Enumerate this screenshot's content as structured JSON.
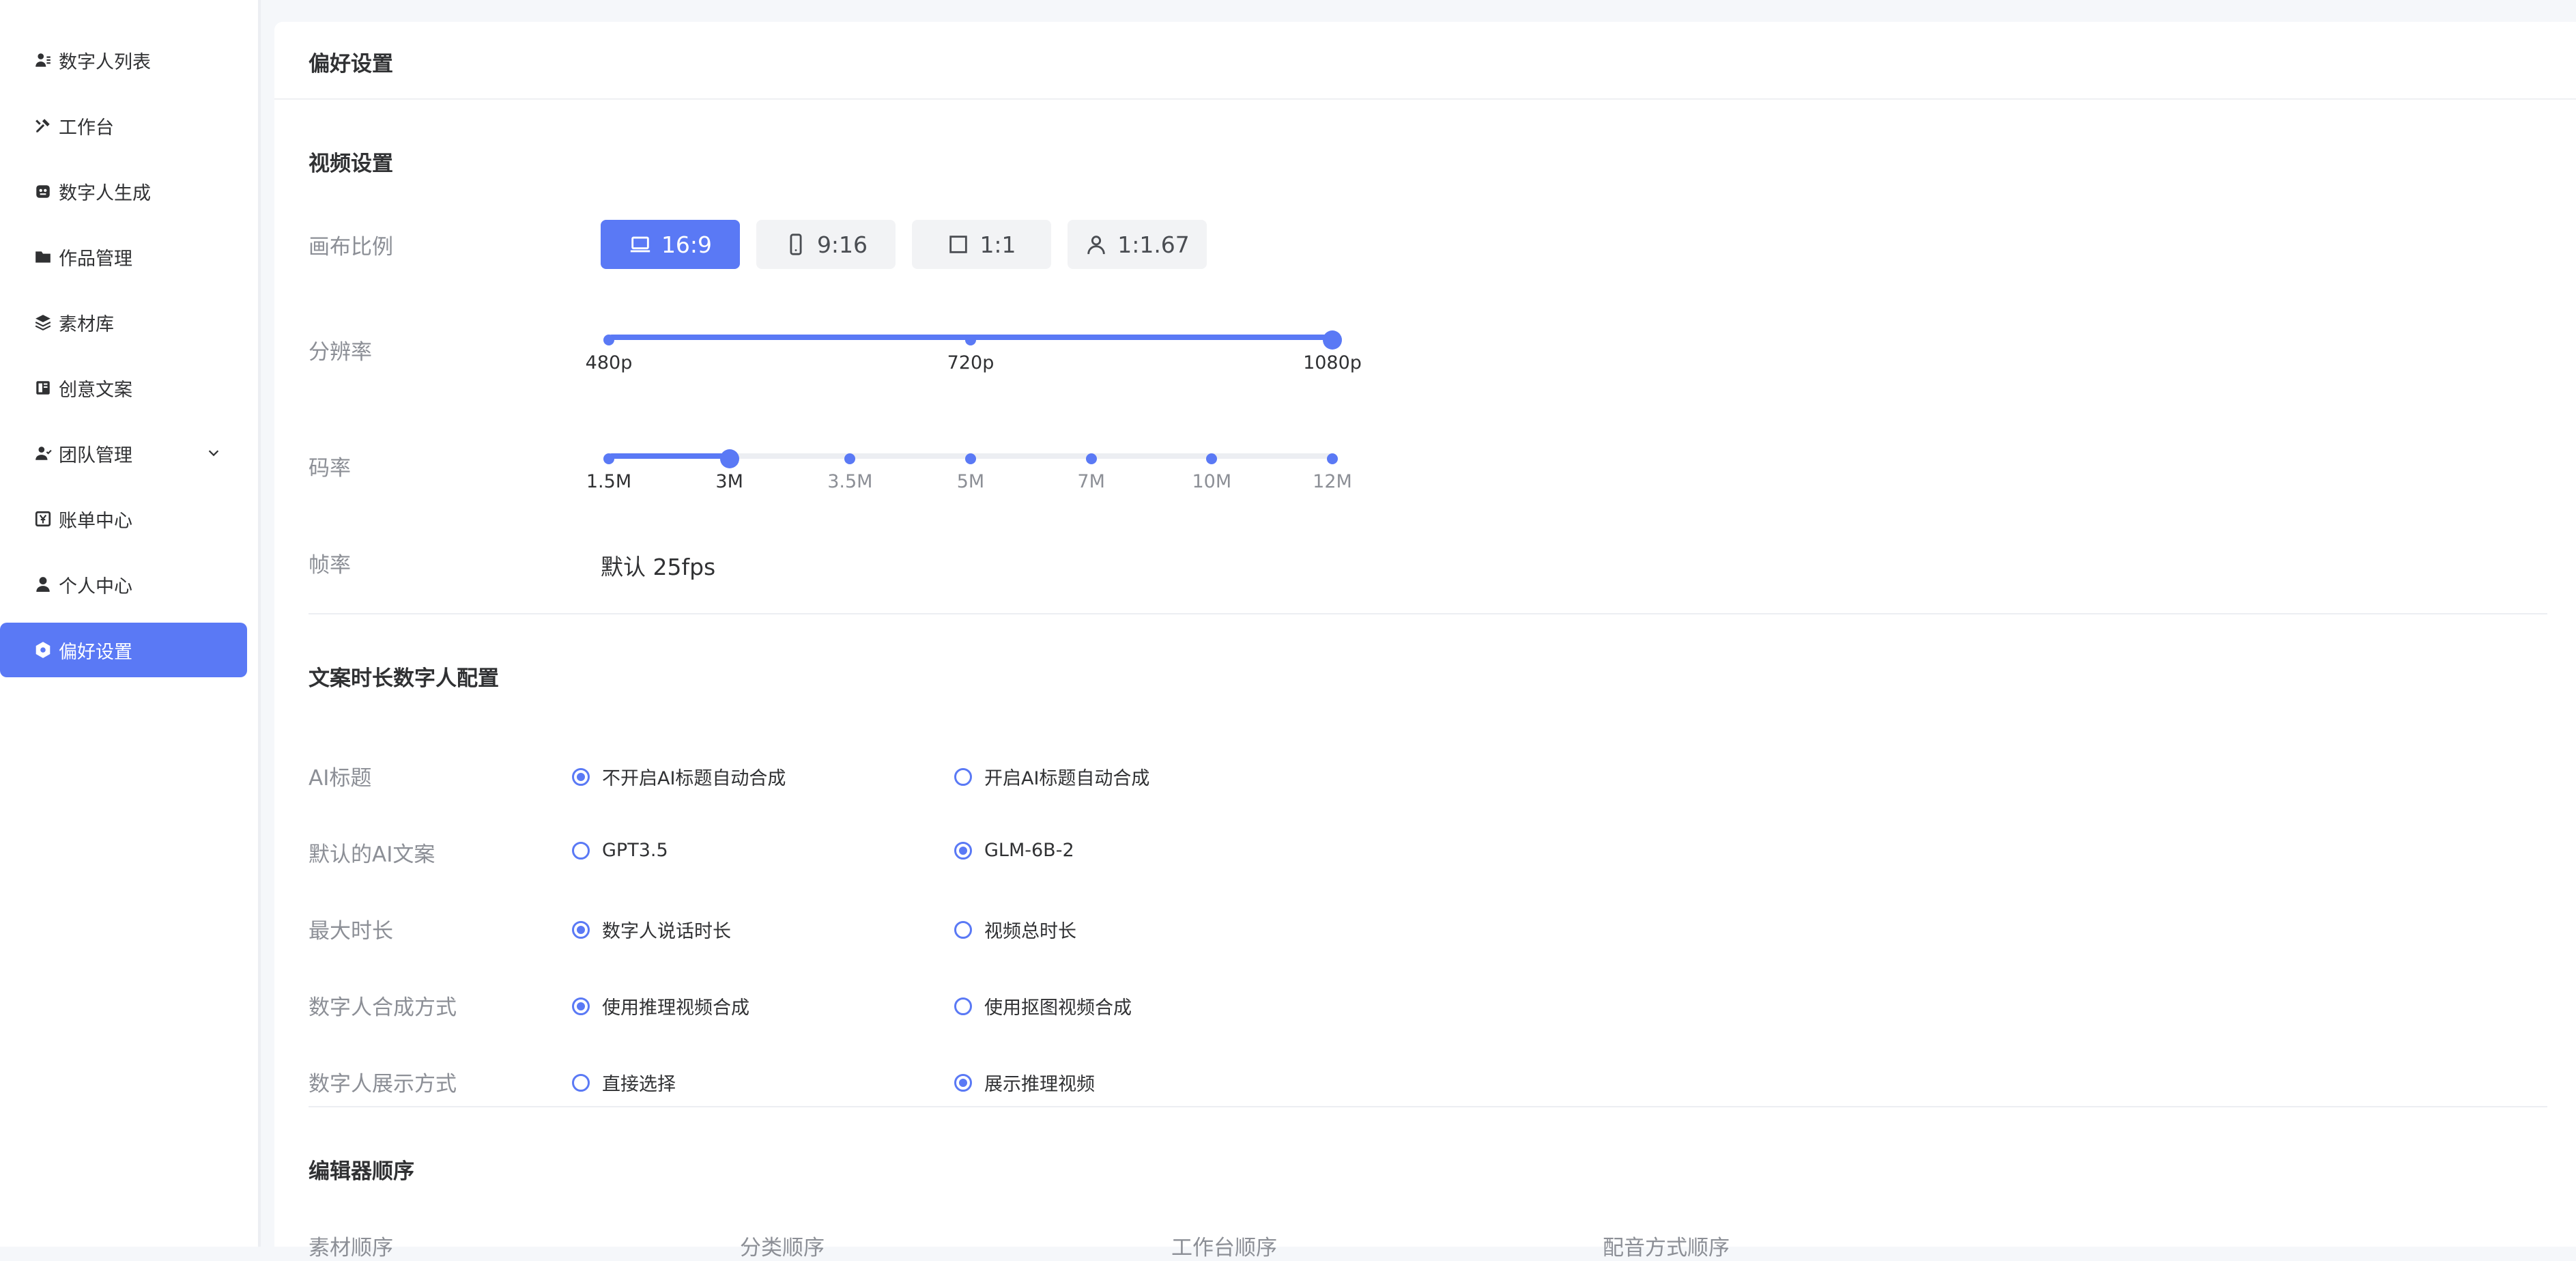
{
  "sidebar": {
    "items": [
      {
        "label": "数字人列表",
        "icon": "user-list-icon",
        "active": false
      },
      {
        "label": "工作台",
        "icon": "tools-icon",
        "active": false
      },
      {
        "label": "数字人生成",
        "icon": "robot-icon",
        "active": false
      },
      {
        "label": "作品管理",
        "icon": "folder-icon",
        "active": false
      },
      {
        "label": "素材库",
        "icon": "layers-icon",
        "active": false
      },
      {
        "label": "创意文案",
        "icon": "document-icon",
        "active": false
      },
      {
        "label": "团队管理",
        "icon": "team-icon",
        "active": false,
        "expandable": true
      },
      {
        "label": "账单中心",
        "icon": "bill-icon",
        "active": false
      },
      {
        "label": "个人中心",
        "icon": "person-icon",
        "active": false
      },
      {
        "label": "偏好设置",
        "icon": "settings-icon",
        "active": true
      }
    ]
  },
  "page": {
    "title": "偏好设置"
  },
  "video": {
    "title": "视频设置",
    "canvas_label": "画布比例",
    "ratios": [
      {
        "label": "16:9",
        "icon": "laptop-icon",
        "selected": true
      },
      {
        "label": "9:16",
        "icon": "phone-icon",
        "selected": false
      },
      {
        "label": "1:1",
        "icon": "square-icon",
        "selected": false
      },
      {
        "label": "1:1.67",
        "icon": "portrait-icon",
        "selected": false
      }
    ],
    "resolution_label": "分辨率",
    "resolution": {
      "options": [
        "480p",
        "720p",
        "1080p"
      ],
      "selected": "1080p"
    },
    "bitrate_label": "码率",
    "bitrate": {
      "options": [
        "1.5M",
        "3M",
        "3.5M",
        "5M",
        "7M",
        "10M",
        "12M"
      ],
      "selected": "3M"
    },
    "fps_label": "帧率",
    "fps_value": "默认 25fps"
  },
  "copy": {
    "title": "文案时长数字人配置",
    "rows": [
      {
        "label": "AI标题",
        "options": [
          "不开启AI标题自动合成",
          "开启AI标题自动合成"
        ],
        "selected": 0
      },
      {
        "label": "默认的AI文案",
        "options": [
          "GPT3.5",
          "GLM-6B-2"
        ],
        "selected": 1
      },
      {
        "label": "最大时长",
        "options": [
          "数字人说话时长",
          "视频总时长"
        ],
        "selected": 0
      },
      {
        "label": "数字人合成方式",
        "options": [
          "使用推理视频合成",
          "使用抠图视频合成"
        ],
        "selected": 0
      },
      {
        "label": "数字人展示方式",
        "options": [
          "直接选择",
          "展示推理视频"
        ],
        "selected": 1
      }
    ]
  },
  "editor": {
    "title": "编辑器顺序",
    "columns": [
      "素材顺序",
      "分类顺序",
      "工作台顺序",
      "配音方式顺序"
    ]
  },
  "colors": {
    "accent": "#5a79f5",
    "muted_text": "#8c8f96",
    "text": "#303133"
  }
}
